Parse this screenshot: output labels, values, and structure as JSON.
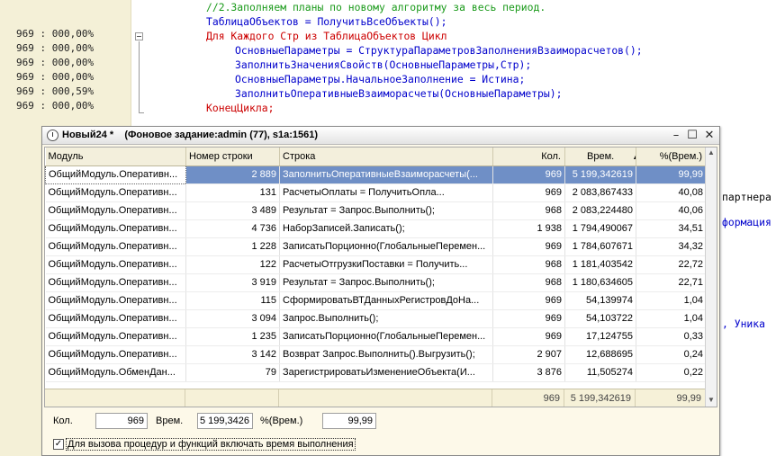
{
  "editor": {
    "gutter_lines": [
      "969 : 000,00%",
      "969 : 000,00%",
      "969 : 000,00%",
      "969 : 000,00%",
      "969 : 000,59%",
      "969 : 000,00%"
    ],
    "code_lines": [
      {
        "text": "//2.Заполняем планы по новому алгоритму за весь период.",
        "color": "#1a9a1a"
      },
      {
        "text": "ТаблицаОбъектов = ПолучитьВсеОбъекты();",
        "color": "#0000cc"
      },
      {
        "text": "Для Каждого Стр из ТаблицаОбъектов Цикл",
        "color": "#cc0000"
      },
      {
        "text": "ОсновныеПараметры = СтруктураПараметровЗаполненияВзаиморасчетов();",
        "color": "#0000cc"
      },
      {
        "text": "ЗаполнитьЗначенияСвойств(ОсновныеПараметры,Стр);",
        "color": "#0000cc"
      },
      {
        "text": "ОсновныеПараметры.НачальноеЗаполнение = Истина;",
        "color": "#0000cc"
      },
      {
        "text": "ЗаполнитьОперативныеВзаиморасчеты(ОсновныеПараметры);",
        "color": "#0000cc"
      },
      {
        "text": "КонецЦикла;",
        "color": "#cc0000"
      }
    ],
    "right_fragments": [
      "партнера",
      "формация",
      ", Уника"
    ]
  },
  "window": {
    "title": "Новый24 *    (Фоновое задание:admin (77), s1a:1561)",
    "buttons": {
      "minimize": "–",
      "maximize": "☐",
      "close": "✕"
    }
  },
  "table": {
    "columns": [
      "Модуль",
      "Номер строки",
      "Строка",
      "Кол.",
      "Врем.",
      "%(Врем.)"
    ],
    "rows": [
      [
        "ОбщийМодуль.Оперативн...",
        "2 889",
        "ЗаполнитьОперативныеВзаиморасчеты(...",
        "969",
        "5 199,342619",
        "99,99"
      ],
      [
        "ОбщийМодуль.Оперативн...",
        "131",
        "РасчетыОплаты          = ПолучитьОпла...",
        "969",
        "2 083,867433",
        "40,08"
      ],
      [
        "ОбщийМодуль.Оперативн...",
        "3 489",
        "Результат      = Запрос.Выполнить();",
        "968",
        "2 083,224480",
        "40,06"
      ],
      [
        "ОбщийМодуль.Оперативн...",
        "4 736",
        "НаборЗаписей.Записать();",
        "1 938",
        "1 794,490067",
        "34,51"
      ],
      [
        "ОбщийМодуль.Оперативн...",
        "1 228",
        "ЗаписатьПорционно(ГлобальныеПеремен...",
        "969",
        "1 784,607671",
        "34,32"
      ],
      [
        "ОбщийМодуль.Оперативн...",
        "122",
        "РасчетыОтгрузкиПоставки     = Получить...",
        "968",
        "1 181,403542",
        "22,72"
      ],
      [
        "ОбщийМодуль.Оперативн...",
        "3 919",
        "Результат      = Запрос.Выполнить();",
        "968",
        "1 180,634605",
        "22,71"
      ],
      [
        "ОбщийМодуль.Оперативн...",
        "115",
        "СформироватьВТДанныхРегистровДоНа...",
        "969",
        "54,139974",
        "1,04"
      ],
      [
        "ОбщийМодуль.Оперативн...",
        "3 094",
        "Запрос.Выполнить();",
        "969",
        "54,103722",
        "1,04"
      ],
      [
        "ОбщийМодуль.Оперативн...",
        "1 235",
        "ЗаписатьПорционно(ГлобальныеПеремен...",
        "969",
        "17,124755",
        "0,33"
      ],
      [
        "ОбщийМодуль.Оперативн...",
        "3 142",
        "Возврат Запрос.Выполнить().Выгрузить();",
        "2 907",
        "12,688695",
        "0,24"
      ],
      [
        "ОбщийМодуль.ОбменДан...",
        "79",
        "ЗарегистрироватьИзменениеОбъекта(И...",
        "3 876",
        "11,505274",
        "0,22"
      ]
    ],
    "totals": {
      "count": "969",
      "time": "5 199,342619",
      "percent": "99,99"
    }
  },
  "bottom": {
    "count_label": "Кол.",
    "count_value": "969",
    "time_label": "Врем.",
    "time_value": "5 199,3426",
    "percent_label": "%(Врем.)",
    "percent_value": "99,99",
    "checkbox_label": "Для вызова процедур и функций включать время выполнения",
    "checkbox_mark": "✓"
  }
}
